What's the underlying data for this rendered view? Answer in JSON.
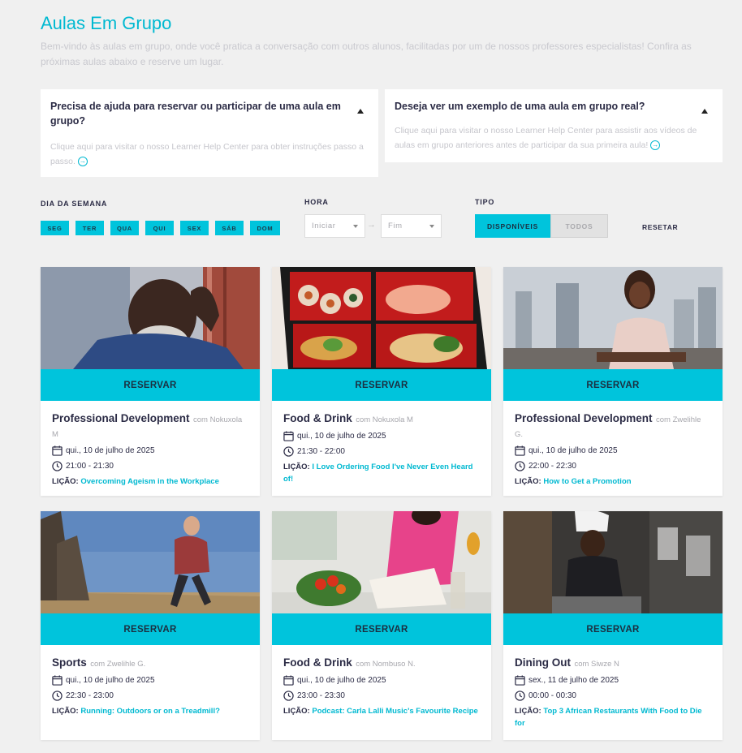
{
  "page": {
    "title": "Aulas Em Grupo",
    "subtitle": "Bem-vindo às aulas em grupo, onde você pratica a conversação com outros alunos, facilitadas por um de nossos professores especialistas! Confira as próximas aulas abaixo e reserve um lugar."
  },
  "help": [
    {
      "question": "Precisa de ajuda para reservar ou participar de uma aula em grupo?",
      "answer": "Clique aqui para visitar o nosso Learner Help Center para obter instruções passo a passo."
    },
    {
      "question": "Deseja ver um exemplo de uma aula em grupo real?",
      "answer": "Clique aqui para visitar o nosso Learner Help Center para assistir aos vídeos de aulas em grupo anteriores antes de participar da sua primeira aula!"
    }
  ],
  "filters": {
    "day_label": "DIA DA SEMANA",
    "days": [
      "SEG",
      "TER",
      "QUA",
      "QUI",
      "SEX",
      "SÁB",
      "DOM"
    ],
    "hour_label": "HORA",
    "start_placeholder": "Iniciar",
    "end_placeholder": "Fim",
    "type_label": "TIPO",
    "type_on": "DISPONÍVEIS",
    "type_off": "TODOS",
    "reset": "RESETAR"
  },
  "reserve_label": "RESERVAR",
  "lesson_prefix": "LIÇÃO:",
  "cards": [
    {
      "topic": "Professional Development",
      "by": "com Nokuxola M",
      "date": "qui., 10 de julho de 2025",
      "time": "21:00 - 21:30",
      "lesson": "Overcoming Ageism in the Workplace"
    },
    {
      "topic": "Food & Drink",
      "by": "com Nokuxola M",
      "date": "qui., 10 de julho de 2025",
      "time": "21:30 - 22:00",
      "lesson": "I Love Ordering Food I've Never Even Heard of!"
    },
    {
      "topic": "Professional Development",
      "by": "com Zwelihle G.",
      "date": "qui., 10 de julho de 2025",
      "time": "22:00 - 22:30",
      "lesson": "How to Get a Promotion"
    },
    {
      "topic": "Sports",
      "by": "com Zwelihle G.",
      "date": "qui., 10 de julho de 2025",
      "time": "22:30 - 23:00",
      "lesson": "Running: Outdoors or on a Treadmill?"
    },
    {
      "topic": "Food & Drink",
      "by": "com Nombuso N.",
      "date": "qui., 10 de julho de 2025",
      "time": "23:00 - 23:30",
      "lesson": "Podcast: Carla Lalli Music's Favourite Recipe"
    },
    {
      "topic": "Dining Out",
      "by": "com Siwze N",
      "date": "sex., 11 de julho de 2025",
      "time": "00:00 - 00:30",
      "lesson": "Top 3 African Restaurants With Food to Die for"
    }
  ],
  "colors": {
    "accent": "#00c4dc",
    "title": "#00b9d1",
    "text": "#2b2b45",
    "muted": "#a7a7ad"
  }
}
